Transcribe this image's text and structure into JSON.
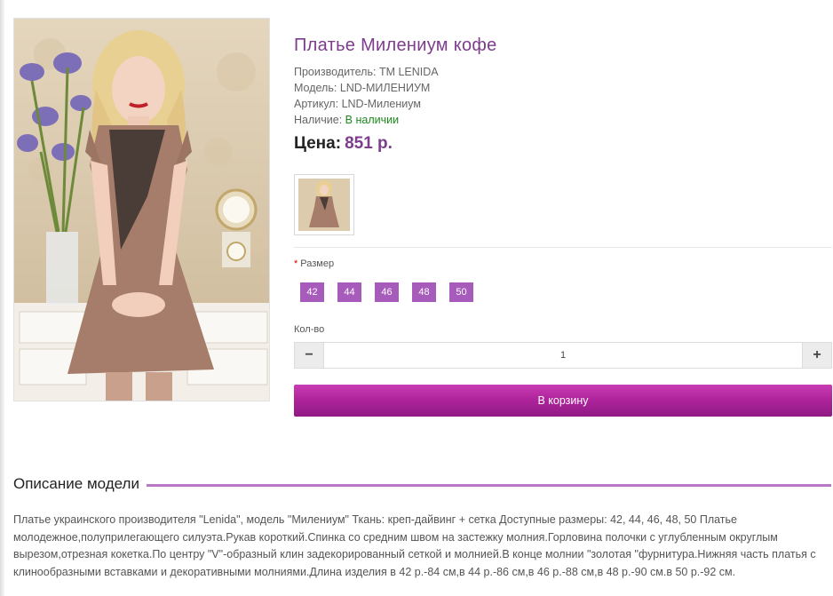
{
  "product": {
    "title": "Платье Милениум кофе",
    "manufacturer_label": "Производитель:",
    "manufacturer": "TM LENIDA",
    "model_label": "Модель:",
    "model": "LND-МИЛЕНИУМ",
    "sku_label": "Артикул:",
    "sku": "LND-Милениум",
    "stock_label": "Наличие:",
    "stock": "В наличии",
    "price_label": "Цена:",
    "price": "851 р."
  },
  "options": {
    "size_label": "Размер",
    "required_mark": "*",
    "sizes": [
      "42",
      "44",
      "46",
      "48",
      "50"
    ],
    "qty_label": "Кол-во",
    "qty_value": "1",
    "minus": "−",
    "plus": "+"
  },
  "cart": {
    "button_label": "В корзину"
  },
  "description": {
    "heading": "Описание модели",
    "text": "Платье украинского производителя \"Lenida\", модель \"Милениум\" Ткань: креп-дайвинг + сетка Доступные размеры: 42, 44, 46, 48, 50 Платье молодежное,полуприлегающего силуэта.Рукав короткий.Спинка со средним швом на застежку молния.Горловина полочки с углубленным округлым вырезом,отрезная кокетка.По центру \"V\"-образный клин задекорированный сеткой и молнией.В конце молнии \"золотая \"фурнитура.Нижняя часть платья с клинообразными вставками и декоративными молниями.Длина изделия в 42 р.-84 см,в 44 р.-86 см,в 46 р.-88 см,в 48 р.-90 см.в 50 р.-92 см."
  },
  "colors": {
    "accent": "#7d3c8c",
    "size_button": "#a75cbb",
    "cart_button": "#b0249c",
    "in_stock": "#1d8a1d"
  }
}
